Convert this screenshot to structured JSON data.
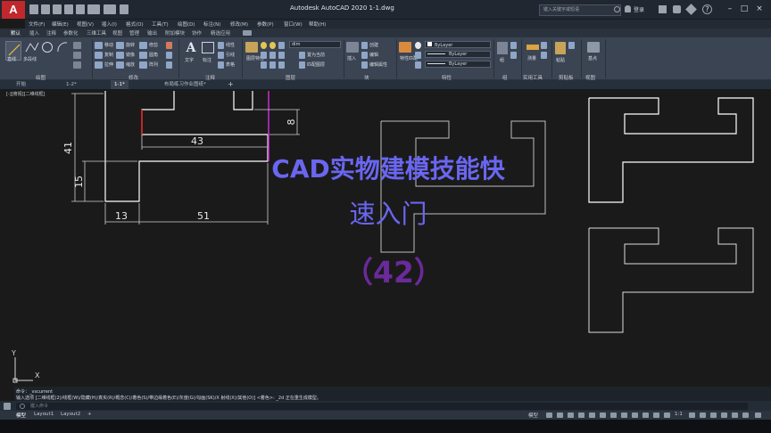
{
  "window": {
    "title": "Autodesk AutoCAD 2020    1-1.dwg",
    "logo": "A",
    "search_placeholder": "键入关键字或短语",
    "user": "登录"
  },
  "menus": [
    "文件(F)",
    "编辑(E)",
    "视图(V)",
    "插入(I)",
    "格式(O)",
    "工具(T)",
    "绘图(D)",
    "标注(N)",
    "修改(M)",
    "参数(P)",
    "窗口(W)",
    "帮助(H)"
  ],
  "ribbon": {
    "tabs": [
      "默认",
      "插入",
      "注释",
      "参数化",
      "三维工具",
      "视图",
      "管理",
      "输出",
      "附加模块",
      "协作",
      "精选应用"
    ],
    "panels": [
      "绘图",
      "修改",
      "注释",
      "图层",
      "块",
      "特性",
      "组",
      "实用工具",
      "剪贴板",
      "视图"
    ],
    "draw_tools": [
      "直线",
      "多段线"
    ],
    "modify_tools": [
      "移动",
      "旋转",
      "修剪",
      "复制",
      "镜像",
      "圆角",
      "拉伸",
      "缩放",
      "阵列"
    ],
    "annot_tools": [
      "文字",
      "标注",
      "线性",
      "引线",
      "表格"
    ],
    "layer_tools": [
      "图层特性",
      "置为当前",
      "匹配图层"
    ],
    "layer_name": "dim",
    "block_tools": [
      "插入",
      "创建",
      "编辑",
      "编辑属性"
    ],
    "prop_tools": [
      "特性匹配"
    ],
    "prop_values": [
      "ByLayer",
      "ByLayer",
      "ByLayer"
    ],
    "util_tools": [
      "组",
      "测量",
      "粘贴",
      "基点"
    ]
  },
  "doc_tabs": [
    "开始",
    "1-2*",
    "1-1*",
    "布局练习作业图纸*"
  ],
  "viewport_label": "[-][俯视][二维线框]",
  "dims": {
    "d1": "41",
    "d2": "8",
    "d3": "43",
    "d4": "15",
    "d5": "13",
    "d6": "51"
  },
  "overlay": {
    "line1": "CAD实物建模技能快",
    "line2": "速入门",
    "line3": "（42）"
  },
  "ucs": {
    "x": "X",
    "y": "Y"
  },
  "command": {
    "line1": "命令：_vscurrent",
    "line2": "输入选项 [二维线框(2)/线框(W)/隐藏(H)/真实(R)/概念(C)/着色(S)/带边缘着色(E)/灰度(G)/勾画(SK)/X 射线(X)/其他(O)] <着色>: _2d 正在重生成模型。",
    "input_placeholder": "键入命令"
  },
  "layout_tabs": [
    "模型",
    "Layout1",
    "Layout2"
  ],
  "status": {
    "label": "模型",
    "scale": "1:1"
  }
}
